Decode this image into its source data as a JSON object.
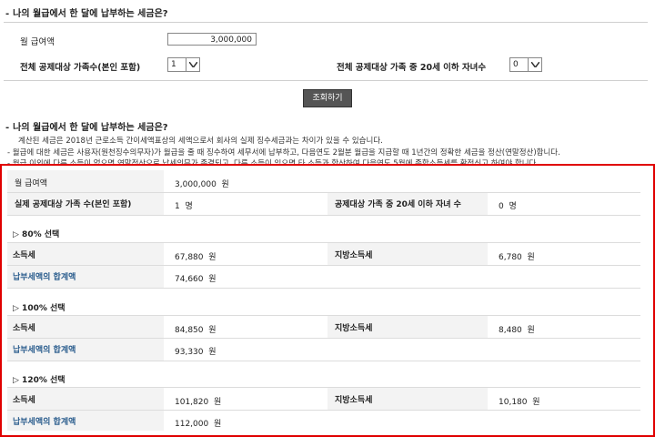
{
  "top_section": {
    "title": "나의 월급에서 한 달에 납부하는 세금은?",
    "salary_label": "월 급여액",
    "salary_value": "3,000,000",
    "family_label": "전체 공제대상 가족수(본인 포함)",
    "family_value": "1",
    "children_label": "전체 공제대상 가족 중 20세 이하 자녀수",
    "children_value": "0",
    "submit_label": "조회하기"
  },
  "result_section": {
    "title": "나의 월급에서 한 달에 납부하는 세금은?",
    "notes": [
      "계산된 세금은 2018년 근로소득 간이세액표상의 세액으로서 회사의 실제 징수세금과는 차이가 있을 수 있습니다.",
      "- 월급에 대한 세금은 사용자(원천징수의무자)가 월급을 줄 때 징수하여 세무서에 납부하고, 다음연도 2월분 월급을 지급할 때 1년간의 정확한 세금을 정산(연말정산)합니다.",
      "- 월급 이외에 다른 소득이 없으면 연말정산으로 납세의무가 종결되고, 다른 소득이 있으면 타 소득과 합산하여 다음연도 5월에 종합소득세를 확정신고 하여야 합니다."
    ]
  },
  "summary": {
    "salary_label": "월 급여액",
    "salary_value": "3,000,000",
    "salary_unit": "원",
    "family_label": "실제 공제대상 가족 수(본인 포함)",
    "family_value": "1",
    "family_unit": "명",
    "children_label": "공제대상 가족 중 20세 이하 자녀 수",
    "children_value": "0",
    "children_unit": "명"
  },
  "options": [
    {
      "heading": "▷ 80% 선택",
      "income_tax_label": "소득세",
      "income_tax_value": "67,880",
      "local_tax_label": "지방소득세",
      "local_tax_value": "6,780",
      "total_label": "납부세액의 합계액",
      "total_value": "74,660",
      "unit": "원"
    },
    {
      "heading": "▷ 100% 선택",
      "income_tax_label": "소득세",
      "income_tax_value": "84,850",
      "local_tax_label": "지방소득세",
      "local_tax_value": "8,480",
      "total_label": "납부세액의 합계액",
      "total_value": "93,330",
      "unit": "원"
    },
    {
      "heading": "▷ 120% 선택",
      "income_tax_label": "소득세",
      "income_tax_value": "101,820",
      "local_tax_label": "지방소득세",
      "local_tax_value": "10,180",
      "total_label": "납부세액의 합계액",
      "total_value": "112,000",
      "unit": "원"
    }
  ],
  "colors": {
    "highlight_border": "#e00000",
    "link_text": "#2c5e8e",
    "button_bg": "#555555"
  }
}
